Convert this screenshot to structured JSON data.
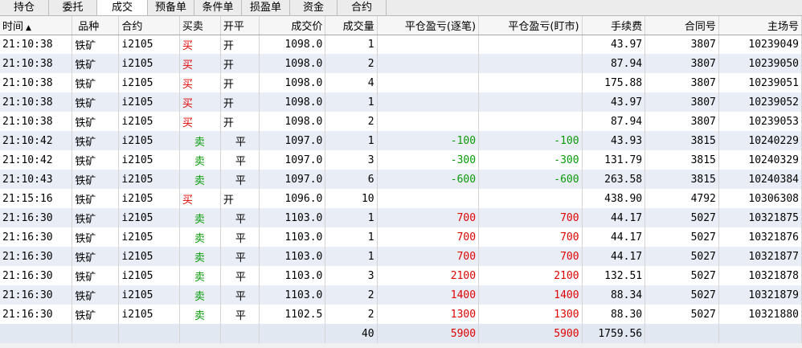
{
  "tabs": [
    {
      "label": "持仓",
      "active": false
    },
    {
      "label": "委托",
      "active": false
    },
    {
      "label": "成交",
      "active": true
    },
    {
      "label": "预备单",
      "active": false
    },
    {
      "label": "条件单",
      "active": false
    },
    {
      "label": "损盈单",
      "active": false
    },
    {
      "label": "资金",
      "active": false
    },
    {
      "label": "合约",
      "active": false
    }
  ],
  "columns": {
    "time": "时间",
    "variety": "品种",
    "contract": "合约",
    "buysell": "买卖",
    "openclose": "开平",
    "price": "成交价",
    "qty": "成交量",
    "pnl_trade": "平仓盈亏(逐笔)",
    "pnl_market": "平仓盈亏(盯市)",
    "fee": "手续费",
    "contract_no": "合同号",
    "exchange_no": "主场号"
  },
  "sort_glyph": "▲",
  "rows": [
    {
      "time": "21:10:38",
      "variety": "铁矿",
      "contract": "i2105",
      "bs": "买",
      "oc": "开",
      "price": "1098.0",
      "qty": "1",
      "pnl_t": "",
      "pnl_m": "",
      "fee": "43.97",
      "cno": "3807",
      "eno": "10239049"
    },
    {
      "time": "21:10:38",
      "variety": "铁矿",
      "contract": "i2105",
      "bs": "买",
      "oc": "开",
      "price": "1098.0",
      "qty": "2",
      "pnl_t": "",
      "pnl_m": "",
      "fee": "87.94",
      "cno": "3807",
      "eno": "10239050"
    },
    {
      "time": "21:10:38",
      "variety": "铁矿",
      "contract": "i2105",
      "bs": "买",
      "oc": "开",
      "price": "1098.0",
      "qty": "4",
      "pnl_t": "",
      "pnl_m": "",
      "fee": "175.88",
      "cno": "3807",
      "eno": "10239051"
    },
    {
      "time": "21:10:38",
      "variety": "铁矿",
      "contract": "i2105",
      "bs": "买",
      "oc": "开",
      "price": "1098.0",
      "qty": "1",
      "pnl_t": "",
      "pnl_m": "",
      "fee": "43.97",
      "cno": "3807",
      "eno": "10239052"
    },
    {
      "time": "21:10:38",
      "variety": "铁矿",
      "contract": "i2105",
      "bs": "买",
      "oc": "开",
      "price": "1098.0",
      "qty": "2",
      "pnl_t": "",
      "pnl_m": "",
      "fee": "87.94",
      "cno": "3807",
      "eno": "10239053"
    },
    {
      "time": "21:10:42",
      "variety": "铁矿",
      "contract": "i2105",
      "bs": "卖",
      "oc": "平",
      "price": "1097.0",
      "qty": "1",
      "pnl_t": "-100",
      "pnl_m": "-100",
      "fee": "43.93",
      "cno": "3815",
      "eno": "10240229"
    },
    {
      "time": "21:10:42",
      "variety": "铁矿",
      "contract": "i2105",
      "bs": "卖",
      "oc": "平",
      "price": "1097.0",
      "qty": "3",
      "pnl_t": "-300",
      "pnl_m": "-300",
      "fee": "131.79",
      "cno": "3815",
      "eno": "10240329"
    },
    {
      "time": "21:10:43",
      "variety": "铁矿",
      "contract": "i2105",
      "bs": "卖",
      "oc": "平",
      "price": "1097.0",
      "qty": "6",
      "pnl_t": "-600",
      "pnl_m": "-600",
      "fee": "263.58",
      "cno": "3815",
      "eno": "10240384"
    },
    {
      "time": "21:15:16",
      "variety": "铁矿",
      "contract": "i2105",
      "bs": "买",
      "oc": "开",
      "price": "1096.0",
      "qty": "10",
      "pnl_t": "",
      "pnl_m": "",
      "fee": "438.90",
      "cno": "4792",
      "eno": "10306308"
    },
    {
      "time": "21:16:30",
      "variety": "铁矿",
      "contract": "i2105",
      "bs": "卖",
      "oc": "平",
      "price": "1103.0",
      "qty": "1",
      "pnl_t": "700",
      "pnl_m": "700",
      "fee": "44.17",
      "cno": "5027",
      "eno": "10321875"
    },
    {
      "time": "21:16:30",
      "variety": "铁矿",
      "contract": "i2105",
      "bs": "卖",
      "oc": "平",
      "price": "1103.0",
      "qty": "1",
      "pnl_t": "700",
      "pnl_m": "700",
      "fee": "44.17",
      "cno": "5027",
      "eno": "10321876"
    },
    {
      "time": "21:16:30",
      "variety": "铁矿",
      "contract": "i2105",
      "bs": "卖",
      "oc": "平",
      "price": "1103.0",
      "qty": "1",
      "pnl_t": "700",
      "pnl_m": "700",
      "fee": "44.17",
      "cno": "5027",
      "eno": "10321877"
    },
    {
      "time": "21:16:30",
      "variety": "铁矿",
      "contract": "i2105",
      "bs": "卖",
      "oc": "平",
      "price": "1103.0",
      "qty": "3",
      "pnl_t": "2100",
      "pnl_m": "2100",
      "fee": "132.51",
      "cno": "5027",
      "eno": "10321878"
    },
    {
      "time": "21:16:30",
      "variety": "铁矿",
      "contract": "i2105",
      "bs": "卖",
      "oc": "平",
      "price": "1103.0",
      "qty": "2",
      "pnl_t": "1400",
      "pnl_m": "1400",
      "fee": "88.34",
      "cno": "5027",
      "eno": "10321879"
    },
    {
      "time": "21:16:30",
      "variety": "铁矿",
      "contract": "i2105",
      "bs": "卖",
      "oc": "平",
      "price": "1102.5",
      "qty": "2",
      "pnl_t": "1300",
      "pnl_m": "1300",
      "fee": "88.30",
      "cno": "5027",
      "eno": "10321880"
    }
  ],
  "totals": {
    "qty": "40",
    "pnl_t": "5900",
    "pnl_m": "5900",
    "fee": "1759.56"
  },
  "colors": {
    "buy": "#e00000",
    "sell": "#0a9a0a",
    "profit": "#e00000",
    "loss": "#0a9a0a"
  }
}
